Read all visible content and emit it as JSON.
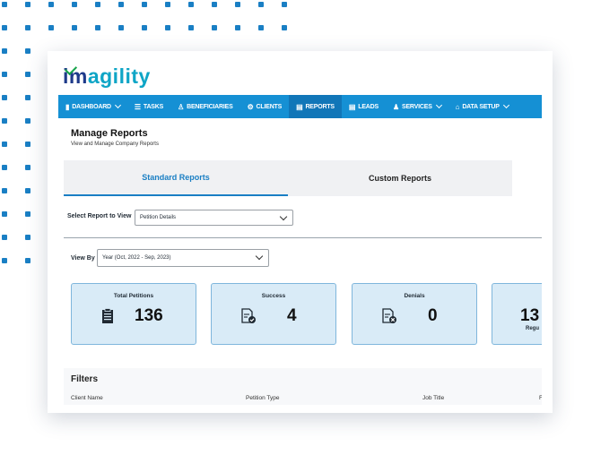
{
  "logo": {
    "text_a": "im",
    "text_b": "agility"
  },
  "nav": [
    {
      "label": "DASHBOARD",
      "icon": "bar-chart-icon",
      "caret": true
    },
    {
      "label": "TASKS",
      "icon": "tasks-icon",
      "caret": false
    },
    {
      "label": "BENEFICIARIES",
      "icon": "people-icon",
      "caret": false
    },
    {
      "label": "CLIENTS",
      "icon": "clients-icon",
      "caret": false
    },
    {
      "label": "REPORTS",
      "icon": "document-icon",
      "caret": false,
      "active": true
    },
    {
      "label": "LEADS",
      "icon": "leads-icon",
      "caret": false
    },
    {
      "label": "SERVICES",
      "icon": "services-icon",
      "caret": true
    },
    {
      "label": "DATA SETUP",
      "icon": "home-icon",
      "caret": true
    }
  ],
  "page": {
    "title": "Manage Reports",
    "subtitle": "View and Manage Company Reports"
  },
  "tabs": {
    "standard": "Standard Reports",
    "custom": "Custom Reports"
  },
  "report_select": {
    "label": "Select Report to View",
    "value": "Petition Details"
  },
  "view_by": {
    "label": "View By",
    "value": "Year (Oct, 2022 - Sep, 2023)"
  },
  "stats": [
    {
      "label": "Total Petitions",
      "value": "136",
      "icon": "clipboard-icon"
    },
    {
      "label": "Success",
      "value": "4",
      "icon": "document-check-icon"
    },
    {
      "label": "Denials",
      "value": "0",
      "icon": "document-x-icon"
    },
    {
      "label": "",
      "value": "13",
      "sub": "Regu"
    }
  ],
  "filters": {
    "title": "Filters",
    "columns": [
      "Client Name",
      "Petition Type",
      "Job Title",
      "F"
    ]
  },
  "colors": {
    "nav": "#1590d4",
    "accent": "#1a7fc4",
    "stat_bg": "#d9ebf7",
    "dots": "#1a7fc4"
  }
}
